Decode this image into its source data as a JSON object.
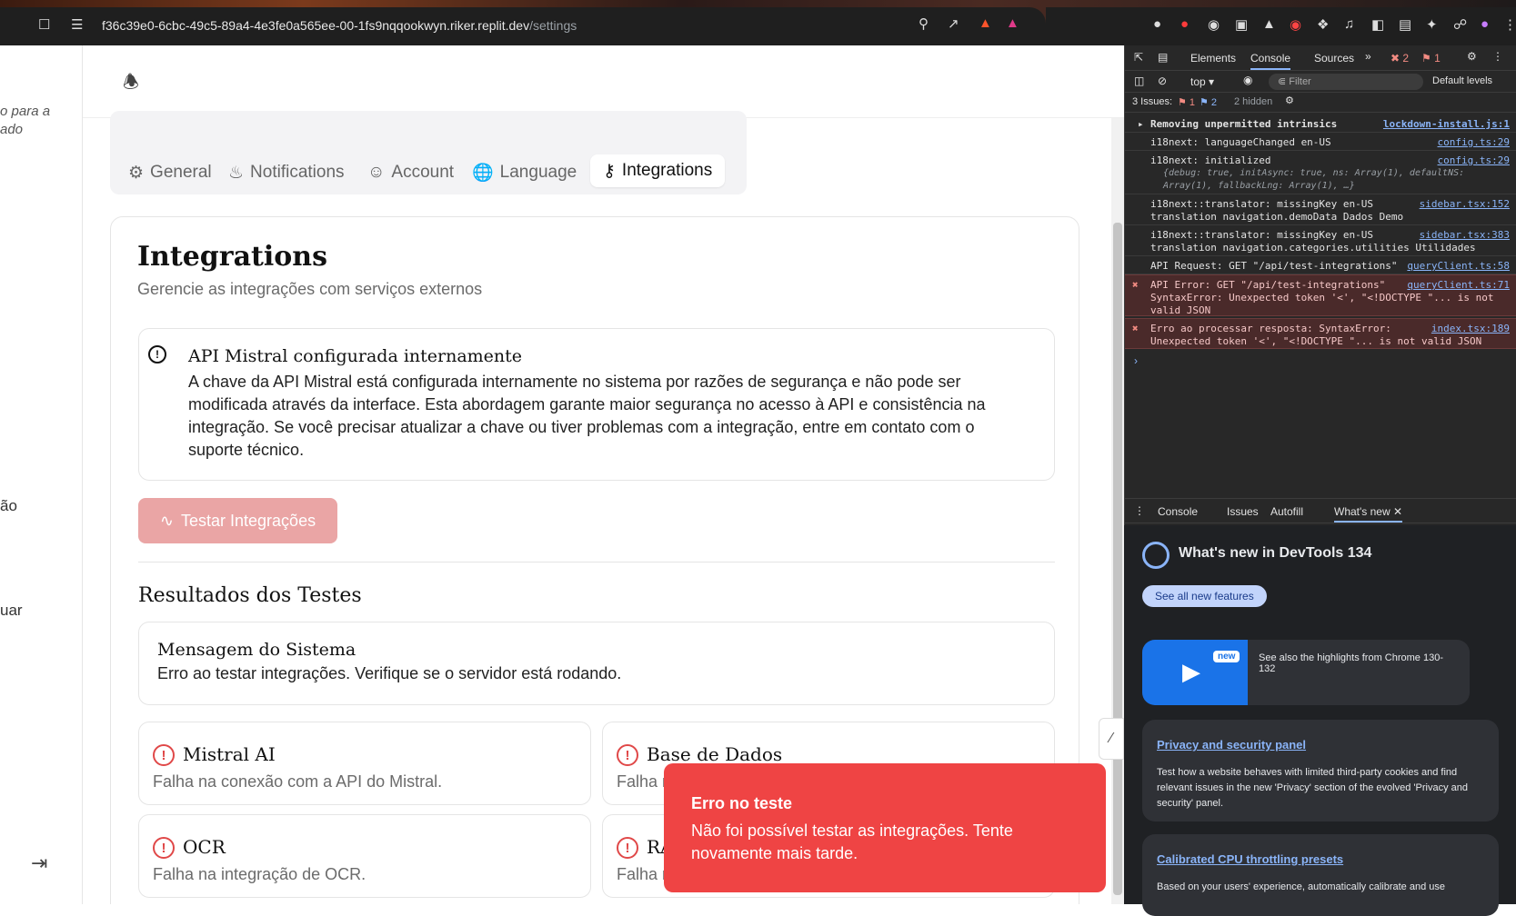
{
  "browser": {
    "url_main": "f36c39e0-6cbc-49c5-89a4-4e3fe0a565ee-00-1fs9nqqookwyn.riker.replit.dev",
    "url_path": "/settings"
  },
  "sidebar": {
    "fragment_1": "o para a",
    "fragment_2": "ado",
    "fragment_3": "ão",
    "fragment_4": "uar"
  },
  "tabs": [
    {
      "label": "General",
      "icon": "gear-icon"
    },
    {
      "label": "Notifications",
      "icon": "bell-icon"
    },
    {
      "label": "Account",
      "icon": "user-icon"
    },
    {
      "label": "Language",
      "icon": "globe-icon"
    },
    {
      "label": "Integrations",
      "icon": "key-icon",
      "active": true
    }
  ],
  "card": {
    "title": "Integrations",
    "subtitle": "Gerencie as integrações com serviços externos"
  },
  "info": {
    "title": "API Mistral configurada internamente",
    "body": "A chave da API Mistral está configurada internamente no sistema por razões de segurança e não pode ser modificada através da interface. Esta abordagem garante maior segurança no acesso à API e consistência na integração. Se você precisar atualizar a chave ou tiver problemas com a integração, entre em contato com o suporte técnico."
  },
  "test_button_label": "Testar Integrações",
  "results": {
    "title": "Resultados dos Testes",
    "system_message_title": "Mensagem do Sistema",
    "system_message_body": "Erro ao testar integrações. Verifique se o servidor está rodando.",
    "items": [
      {
        "title": "Mistral AI",
        "body": "Falha na conexão com a API do Mistral."
      },
      {
        "title": "Base de Dados",
        "body": "Falha na conexão com a base de dados."
      },
      {
        "title": "OCR",
        "body": "Falha na integração de OCR."
      },
      {
        "title": "RA",
        "body": "Falha n"
      }
    ]
  },
  "toast": {
    "title": "Erro no teste",
    "body": "Não foi possível testar as integrações. Tente novamente mais tarde.",
    "color": "#ef4444"
  },
  "devtools": {
    "tabs": [
      "Elements",
      "Console",
      "Sources"
    ],
    "active_tab": "Console",
    "error_count": "2",
    "issue_count": "1",
    "context": "top",
    "filter_placeholder": "Filter",
    "levels": "Default levels",
    "issues_label": "3 Issues:",
    "issues_err": "1",
    "issues_info": "2",
    "hidden": "2 hidden",
    "console_lines": [
      {
        "text": "Removing unpermitted intrinsics",
        "src": "lockdown-install.js:1",
        "bold": true
      },
      {
        "text": "i18next: languageChanged en-US",
        "src": "config.ts:29"
      },
      {
        "text": "i18next: initialized",
        "sub": "{debug: true, initAsync: true, ns: Array(1), defaultNS: Array(1), fallbackLng: Array(1), …}",
        "src": "config.ts:29"
      },
      {
        "text": "i18next::translator: missingKey en-US",
        "sub": "translation navigation.demoData Dados Demo",
        "src": "sidebar.tsx:152"
      },
      {
        "text": "i18next::translator: missingKey en-US",
        "sub": "translation navigation.categories.utilities Utilidades",
        "src": "sidebar.tsx:383"
      },
      {
        "text": "API Request: GET \"/api/test-integrations\"",
        "src": "queryClient.ts:58"
      },
      {
        "text": "API Error: GET \"/api/test-integrations\"",
        "sub": "SyntaxError: Unexpected token '<', \"<!DOCTYPE \"... is not",
        "sub2": "valid JSON",
        "src": "queryClient.ts:71",
        "error": true
      },
      {
        "text": "Erro ao processar resposta: SyntaxError:",
        "sub": "Unexpected token '<', \"<!DOCTYPE \"... is not valid JSON",
        "src": "index.tsx:189",
        "error": true
      }
    ],
    "drawer_tabs": [
      "Console",
      "Issues",
      "Autofill",
      "What's new"
    ],
    "whatsnew_title": "What's new in DevTools 134",
    "see_all": "See all new features",
    "new_badge": "new",
    "highlights": "See also the highlights from Chrome 130-132",
    "card1_title": "Privacy and security panel",
    "card1_body": "Test how a website behaves with limited third-party cookies and find relevant issues in the new 'Privacy' section of the evolved 'Privacy and security' panel.",
    "card2_title": "Calibrated CPU throttling presets",
    "card2_body": "Based on your users' experience, automatically calibrate and use"
  }
}
